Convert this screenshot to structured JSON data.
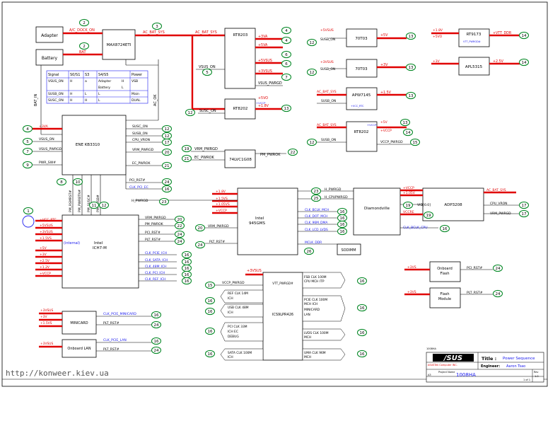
{
  "colors": {
    "net_red": "#e00000",
    "net_blue": "#1a1aee",
    "badge_green": "#0a8a2a",
    "line": "#000000"
  },
  "blocks": {
    "adapter": "Adapter",
    "battery": "Battery",
    "max": "MAX8724ETI",
    "rt8203": "RT8203",
    "rt8202a": "RT8202",
    "rt8202b": "RT8202",
    "ene": "ENE KB3310",
    "lvc": "74LVC1G08",
    "g6903a": "70T03",
    "g6903b": "70T03",
    "apw": "APW7145",
    "rt9173": "RT9173",
    "apl": "APL5315",
    "intel945": [
      "Intel",
      "945GMS"
    ],
    "diamondville": "Diamondville",
    "adp": "ADP3208",
    "ich7": [
      "Intel",
      "ICH7-M"
    ],
    "sodimm": "SODIMM",
    "clkgen": "ICS9LPR426",
    "minicard": "MINICARD",
    "onboard_lan": "Onboard LAN",
    "onboard_flash": [
      "Onboard",
      "Flash"
    ],
    "flash_module": [
      "Flash",
      "Module"
    ]
  },
  "truth_table": {
    "headers": [
      "Signal",
      "S0/S1",
      "S3",
      "S4/S5",
      "Power"
    ],
    "rows": [
      [
        "VSUS_ON",
        "H",
        "a",
        "Adapter",
        "H",
        "VSB"
      ],
      [
        "",
        "",
        "",
        "Battery",
        "L",
        ""
      ],
      [
        "SUSB_ON",
        "H",
        "L",
        "L",
        "",
        "Main"
      ],
      [
        "SUSC_ON",
        "H",
        "H",
        "L",
        "",
        "DUAL"
      ]
    ]
  },
  "nets": {
    "ac_dock_on": "A/C_DOCK_ON",
    "bat": "BAT",
    "ac_bat_sys": "AC_BAT_SYS",
    "ac_bat_sys_short": "AC_BAT_SYS",
    "ac_ok": "AC_OK",
    "bat_in": "BAT_IN",
    "p3va": "+3VA",
    "p5va": "+5VA",
    "p5vsus": "+5VSUS",
    "p3vsus": "+3VSUS",
    "vsus_on": "VSUS_ON",
    "vsus_pwrgd": "VSUS_PWRGD",
    "p5vo": "+5VO",
    "p1v8": "+1.8V",
    "susc_on": "SUSC_ON",
    "susb_on": "SUSB_ON",
    "cpu_vron": "CPU_VRON",
    "vsus_pwrgd2": "VSUS_PWRGD",
    "vrm_pwrgd": "VRM_PWRGD",
    "ec_pwrok": "EC_PWROK",
    "pwr_sw": "PWR_SW#",
    "pm_pwrok": "PM_PWROK",
    "pci_rst": "PCI_RST#",
    "clk_pci_ec": "CLK_PCI_EC",
    "h_pwrgd": "H_PWRGD",
    "pm_rsmrst": "PM_RSMRST#",
    "pm_pwrbtn": "PM_PWRBTN#",
    "pm_susc": "PM_SUSC#",
    "pm_susb": "PM_SUSB#",
    "p5v": "+5V",
    "p3v": "+3V",
    "p1v5": "+1.5V",
    "p1v05": "+1.05V",
    "p2v5": "+2.5V",
    "p1v2": "+1.2V",
    "pvtt_ddr": "+VTT_DDR",
    "vccp": "+VCCP",
    "vccp_pwrgd": "VCCP_PWRGD",
    "h_cpupwrgd": "H_CPUPWRGD",
    "vid": "VID[6:0]",
    "vccre": "VCCRE",
    "clk_bclk_cpu": "CLK_BCLK_CPU",
    "clk_bclk_mch": "CLK_BCLK_MCH",
    "clk_dot_mch": "CLK_DOT_MCH",
    "clk_dot96": "CLK_DREFSSCLK_MCH",
    "clk_96": "CLK_96M_DMA",
    "clk_lcd_lvds": "CLK_LCD_LVDS",
    "mclk_ddr": "MCLK_DDR",
    "plt_rst": "PLT_RST#",
    "vrm_pwrgd2": "VRM_PWRGD",
    "vcc_rtc": "+VCC_RTC",
    "p5vsus_b": "+5VSUS",
    "p3vsus_b": "+3VSUS",
    "p1v05s": "+1.05VS",
    "p1v5s": "+1.5VS",
    "p3v_b": "+3V",
    "p2v5_b": "+2.5V",
    "p1v2_b": "+1.2V",
    "p1v8_b": "+1.8V",
    "vccp_b": "+VCCP",
    "p5v_b": "+5V",
    "internal": "(internal)",
    "clk_pcie_ich": "CLK_PCIE_ICH",
    "clk_sata_ich": "CLK_SATA_ICH",
    "clk_48m_ich": "CLK_48M_ICH",
    "clk_pci_ich": "CLK_PCI_ICH",
    "clk_ref_ich": "CLK_REF_ICH",
    "vcc_pwrgd": "VCC_PWRGD",
    "clk_pcie_minicard": "CLK_PCIE_MINICARD",
    "clk_pcie_lan": "CLK_PCIE_LAN",
    "p3vsus_c": "+3VSUS",
    "p3vsus_d": "+3VSUS",
    "p3vsus_e": "+3VSUS",
    "p3v_flash": "+3VS",
    "p3v_flash2": "+3VS",
    "vccp_pwrgd2": "VCCP_PWRGD",
    "vtt_pwrgd": "VTT_PWRGD#",
    "clk_fsb": [
      "FSB CLK 100M",
      "CPU MCH ITP"
    ],
    "clk_ref14": [
      "REF CLK 14M",
      "ICH"
    ],
    "clk_usb48": [
      "USB CLK 48M",
      "ICH"
    ],
    "clk_pci33": [
      "PCI CLK 33M",
      "ICH EC",
      "DEBUG"
    ],
    "clk_sata": [
      "SATA CLK 100M",
      "ICH"
    ],
    "clk_pcie100": [
      "PCIE CLK 100M",
      "MCH ICH",
      "MINICARD",
      "LAN"
    ],
    "clk_lvds": [
      "LVDS CLK 100M",
      "MCH"
    ],
    "clk_uma96": [
      "UMA CLK 96M",
      "MCH"
    ],
    "pwr_btn_label": "PWR_SW#",
    "p3va_rtc": "+VCC_RTC"
  },
  "badges": {
    "b_ac_dock": "2",
    "b_bat": "2",
    "b_acbat": "3",
    "b_ene_3va": "4",
    "b_vsus_on": "5",
    "b_vsus_pwrgd": "7",
    "b_pwr_sw": "9",
    "b_rt_3va": "4",
    "b_rt_5va": "4",
    "b_rt_5vsus": "6",
    "b_rt_3vsus": "6",
    "b_rt_vsus_pwrgd": "7",
    "b_rt2_5vo": "8",
    "b_rt2_1v8": "13",
    "b_rt2_susc": "12",
    "b_susc": "12",
    "b_susb": "12",
    "b_cpuvron": "17",
    "b_vrmpwrgd": "20",
    "b_ecpwrok": "21",
    "b_vsus_on_in": "5",
    "b_lvc_vrm": "19",
    "b_lvc_ec": "21",
    "b_lvc_out": "22",
    "b_pcirst": "24",
    "b_clkpciec": "16",
    "b_rsmrst": "10",
    "b_pwrbtn": "11",
    "b_susc2": "11",
    "b_susb2": "12",
    "b_8": "8",
    "b_1": "1",
    "b_hpwrgd": "23",
    "b_ich_vrm": "20",
    "b_ich_pm": "22",
    "b_ich_pcirst": "24",
    "b_ich_plt": "24",
    "b_ich_c1": "16",
    "b_ich_c2": "16",
    "b_ich_c3": "16",
    "b_ich_c4": "16",
    "b_ich_c5": "16",
    "b_g1_susb": "12",
    "b_g1_5v": "13",
    "b_g2_susb": "12",
    "b_g2_3v": "13",
    "b_apw_1v5": "13",
    "b_rt9_out": "14",
    "b_apl_out": "14",
    "b_rt2b_susb": "12",
    "b_rt2b_5v": "13",
    "b_rt2b_vccp": "14",
    "b_rt2b_pwrgd": "15",
    "b_945_vrm": "20",
    "b_945_plt": "24",
    "b_945_hpwrgd": "23",
    "b_945_cpupwrgd": "25",
    "b_945_bclk": "16",
    "b_945_dot": "16",
    "b_945_dref": "16",
    "b_945_lcd": "16",
    "b_945_mclk": "26",
    "b_dia_vid": "19",
    "b_dia_clk": "16",
    "b_adp_acbat": "",
    "b_adp_cpu": "17",
    "b_adp_vrm": "17",
    "b_clk_pwrgd": "15",
    "b_clk_a": "16",
    "b_clk_b": "16",
    "b_clk_c": "16",
    "b_clk_d": "16",
    "b_clk_e": "16",
    "b_clk_f": "16",
    "b_clk_g": "16",
    "b_clk_h": "16",
    "b_mini_1": "16",
    "b_mini_2": "24",
    "b_lan_1": "16",
    "b_lan_2": "24",
    "b_flash1": "24",
    "b_flash2": "24"
  },
  "title_block": {
    "brand": "/SUS",
    "title_label": "Title :",
    "title": "Power Sequence",
    "engineer_label": "Engineer:",
    "engineer": "Aaron Tsao",
    "company": "ASUSTek Computer INC.",
    "project_label": "Project Name",
    "project": "1008HA",
    "small_top": "1008HA",
    "rev_label": "Rev",
    "rev": "1.0",
    "size": "A3",
    "sheet": "1 of 1"
  },
  "watermark": "http://konweer.kiev.ua"
}
